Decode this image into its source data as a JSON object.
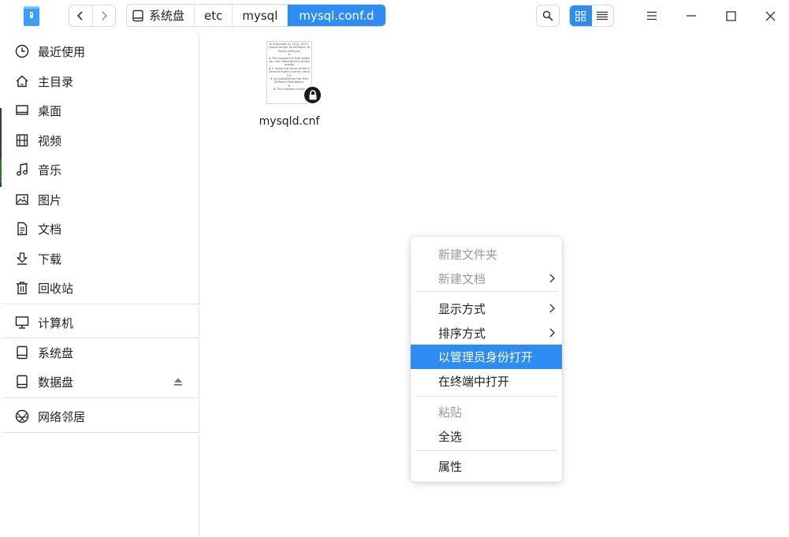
{
  "titlebar": {
    "breadcrumbs": [
      "系统盘",
      "etc",
      "mysql",
      "mysql.conf.d"
    ]
  },
  "sidebar": {
    "items": [
      {
        "label": "最近使用",
        "icon": "clock-icon"
      },
      {
        "label": "主目录",
        "icon": "home-icon"
      },
      {
        "label": "桌面",
        "icon": "desktop-icon"
      },
      {
        "label": "视频",
        "icon": "video-icon"
      },
      {
        "label": "音乐",
        "icon": "music-icon"
      },
      {
        "label": "图片",
        "icon": "picture-icon"
      },
      {
        "label": "文档",
        "icon": "document-icon"
      },
      {
        "label": "下载",
        "icon": "download-icon"
      },
      {
        "label": "回收站",
        "icon": "trash-icon"
      },
      {
        "label": "计算机",
        "icon": "computer-icon"
      },
      {
        "label": "系统盘",
        "icon": "disk-icon"
      },
      {
        "label": "数据盘",
        "icon": "disk-icon"
      },
      {
        "label": "网络邻居",
        "icon": "network-icon"
      }
    ]
  },
  "file": {
    "name": "mysqld.cnf",
    "preview_lines": [
      "# Copyright (c) 2014, 2017,",
      "Oracle and/or its affiliates. All",
      "rights reserved.",
      "#",
      "# This program is free software;",
      "you can redistribute it and/or",
      "modify",
      "# it under the terms of the GNU",
      "General Public License, version",
      "2.0,",
      "# as published by the Free",
      "Software Foundation.",
      "#",
      "# This program is also"
    ]
  },
  "context_menu": {
    "items": [
      {
        "label": "新建文件夹",
        "disabled": true
      },
      {
        "label": "新建文档",
        "disabled": true,
        "submenu": true
      },
      {
        "label": "显示方式",
        "submenu": true
      },
      {
        "label": "排序方式",
        "submenu": true
      },
      {
        "label": "以管理员身份打开",
        "highlighted": true
      },
      {
        "label": "在终端中打开"
      },
      {
        "label": "粘贴",
        "disabled": true
      },
      {
        "label": "全选"
      },
      {
        "label": "属性"
      }
    ]
  },
  "colors": {
    "accent": "#2e8df2",
    "disabled_text": "#9a9a9a"
  }
}
